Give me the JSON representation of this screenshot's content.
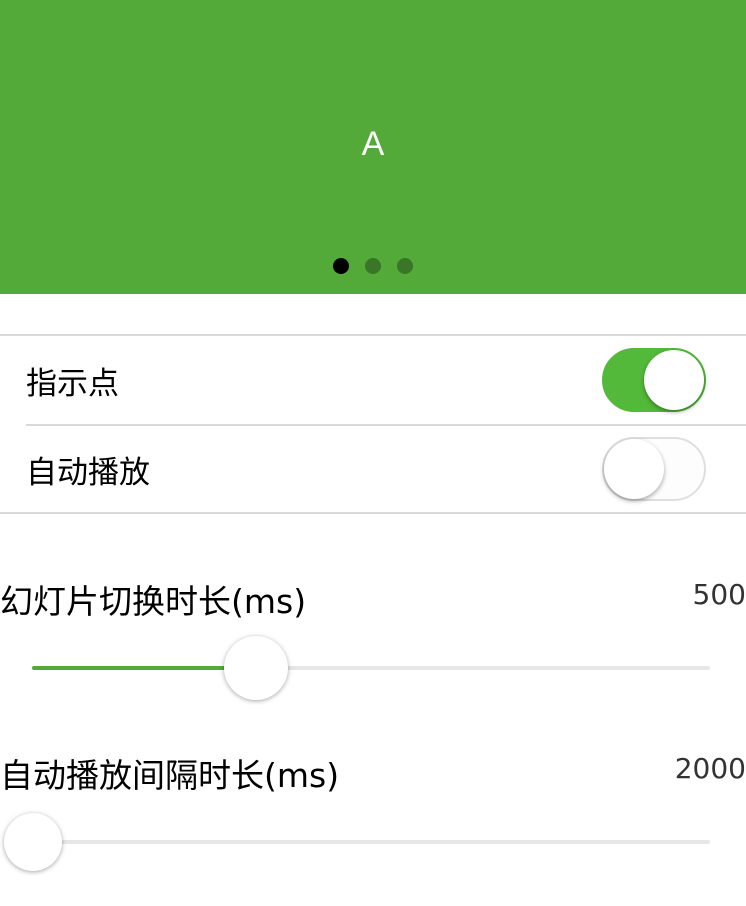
{
  "swiper": {
    "slide_label": "A",
    "dot_count": 3,
    "active_index": 0,
    "background": "#53aa39"
  },
  "settings": {
    "indicator_label": "指示点",
    "indicator_on": true,
    "autoplay_label": "自动播放",
    "autoplay_on": false
  },
  "sliders": {
    "duration": {
      "title": "幻灯片切换时长(ms)",
      "value": "500",
      "fraction": 0.33
    },
    "interval": {
      "title": "自动播放间隔时长(ms)",
      "value": "2000",
      "fraction": 0.0
    }
  },
  "colors": {
    "accent": "#53aa39",
    "switch_on": "#53b93a"
  }
}
